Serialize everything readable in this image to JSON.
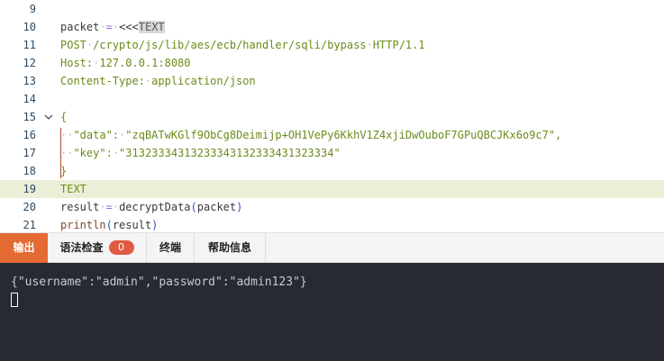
{
  "editor": {
    "lines": [
      {
        "num": "9",
        "tokens": []
      },
      {
        "num": "10",
        "tokens": [
          {
            "t": "packet",
            "c": "ident"
          },
          {
            "t": "·",
            "c": "ws"
          },
          {
            "t": "=",
            "c": "op"
          },
          {
            "t": "·",
            "c": "ws"
          },
          {
            "t": "<<<",
            "c": "kw"
          },
          {
            "t": "TEXT",
            "c": "heredoc"
          }
        ]
      },
      {
        "num": "11",
        "tokens": [
          {
            "t": "POST",
            "c": "str"
          },
          {
            "t": "·",
            "c": "ws"
          },
          {
            "t": "/crypto/js/lib/aes/ecb/handler/sqli/bypass",
            "c": "str"
          },
          {
            "t": "·",
            "c": "ws"
          },
          {
            "t": "HTTP/1.1",
            "c": "str"
          }
        ]
      },
      {
        "num": "12",
        "tokens": [
          {
            "t": "Host:",
            "c": "str"
          },
          {
            "t": "·",
            "c": "ws"
          },
          {
            "t": "127.0.0.1:8080",
            "c": "str"
          }
        ]
      },
      {
        "num": "13",
        "tokens": [
          {
            "t": "Content-Type:",
            "c": "str"
          },
          {
            "t": "·",
            "c": "ws"
          },
          {
            "t": "application/json",
            "c": "str"
          }
        ]
      },
      {
        "num": "14",
        "tokens": []
      },
      {
        "num": "15",
        "fold": true,
        "tokens": [
          {
            "t": "{",
            "c": "str"
          }
        ]
      },
      {
        "num": "16",
        "tokens": [
          {
            "t": "··",
            "c": "ws"
          },
          {
            "t": "\"data\":",
            "c": "str"
          },
          {
            "t": "·",
            "c": "ws"
          },
          {
            "t": "\"zqBATwKGlf9ObCg8Deimijp+OH1VePy6KkhV1Z4xjiDwOuboF7GPuQBCJKx6o9c7\",",
            "c": "str"
          }
        ]
      },
      {
        "num": "17",
        "tokens": [
          {
            "t": "··",
            "c": "ws"
          },
          {
            "t": "\"key\":",
            "c": "str"
          },
          {
            "t": "·",
            "c": "ws"
          },
          {
            "t": "\"31323334313233343132333431323334\"",
            "c": "str"
          }
        ]
      },
      {
        "num": "18",
        "tokens": [
          {
            "t": "}",
            "c": "str"
          }
        ]
      },
      {
        "num": "19",
        "highlight": true,
        "tokens": [
          {
            "t": "TEXT",
            "c": "str"
          }
        ]
      },
      {
        "num": "20",
        "tokens": [
          {
            "t": "result",
            "c": "ident"
          },
          {
            "t": "·",
            "c": "ws"
          },
          {
            "t": "=",
            "c": "op"
          },
          {
            "t": "·",
            "c": "ws"
          },
          {
            "t": "decryptData",
            "c": "ident"
          },
          {
            "t": "(",
            "c": "paren"
          },
          {
            "t": "packet",
            "c": "ident"
          },
          {
            "t": ")",
            "c": "paren"
          }
        ]
      },
      {
        "num": "21",
        "tokens": [
          {
            "t": "println",
            "c": "fn"
          },
          {
            "t": "(",
            "c": "paren"
          },
          {
            "t": "result",
            "c": "ident"
          },
          {
            "t": ")",
            "c": "paren"
          }
        ]
      }
    ]
  },
  "tabs": {
    "output": "输出",
    "syntax_check": "语法检查",
    "syntax_count": "0",
    "terminal": "终端",
    "help": "帮助信息"
  },
  "output": {
    "text": "{\"username\":\"admin\",\"password\":\"admin123\"}"
  },
  "colors": {
    "active_tab": "#e36a33",
    "badge": "#e05a43",
    "output_bg": "#272a33",
    "highlight_line": "#ecefd8"
  }
}
